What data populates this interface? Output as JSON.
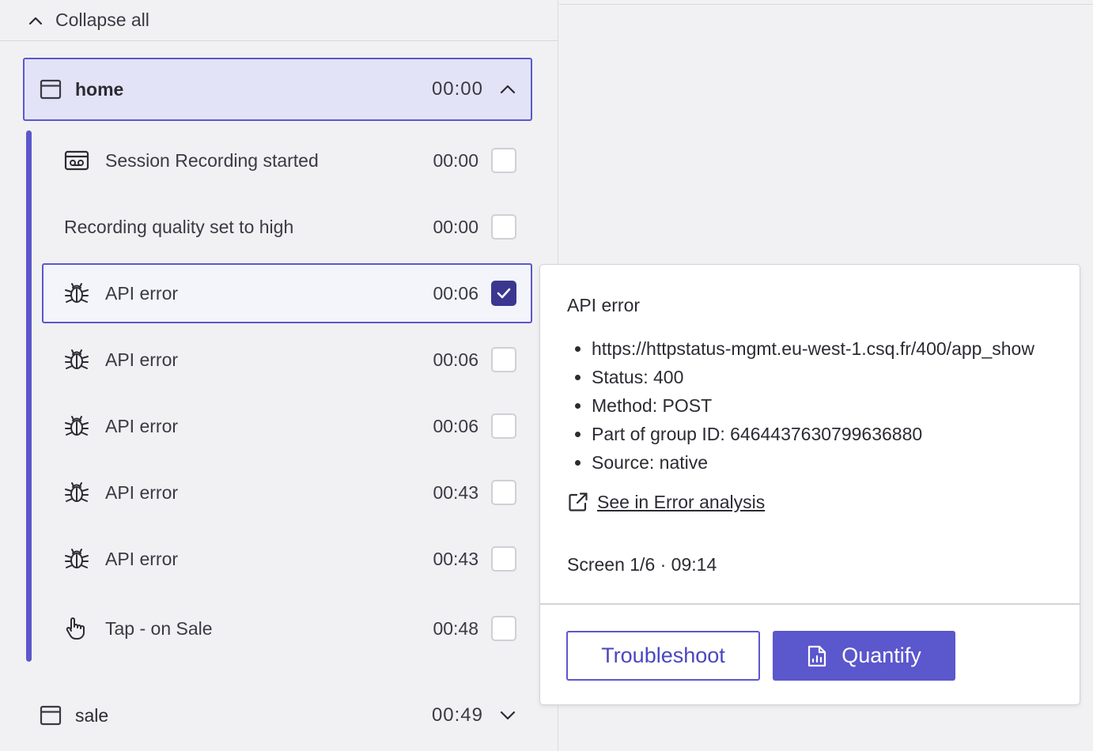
{
  "toolbar": {
    "collapse_all": "Collapse all"
  },
  "screens": [
    {
      "name": "home",
      "time": "00:00",
      "expanded": true,
      "events": [
        {
          "label": "Session Recording started",
          "time": "00:00",
          "icon": "recording-icon",
          "checked": false
        },
        {
          "label": "Recording quality set to high",
          "time": "00:00",
          "icon": "",
          "checked": false
        },
        {
          "label": "API error",
          "time": "00:06",
          "icon": "bug-icon",
          "checked": true
        },
        {
          "label": "API error",
          "time": "00:06",
          "icon": "bug-icon",
          "checked": false
        },
        {
          "label": "API error",
          "time": "00:06",
          "icon": "bug-icon",
          "checked": false
        },
        {
          "label": "API error",
          "time": "00:43",
          "icon": "bug-icon",
          "checked": false
        },
        {
          "label": "API error",
          "time": "00:43",
          "icon": "bug-icon",
          "checked": false
        },
        {
          "label": "Tap - on Sale",
          "time": "00:48",
          "icon": "tap-hand-icon",
          "checked": false
        }
      ]
    },
    {
      "name": "sale",
      "time": "00:49",
      "expanded": false
    }
  ],
  "tooltip": {
    "title": "API error",
    "details": [
      "https://httpstatus-mgmt.eu-west-1.csq.fr/400/app_show",
      "Status: 400",
      "Method: POST",
      "Part of group ID: 6464437630799636880",
      "Source: native"
    ],
    "link_label": "See in Error analysis",
    "screen_info": "Screen 1/6 · 09:14",
    "troubleshoot_label": "Troubleshoot",
    "quantify_label": "Quantify"
  },
  "colors": {
    "accent": "#5b57cc",
    "checked": "#3b378f",
    "selected_header_bg": "#e3e3f7"
  }
}
